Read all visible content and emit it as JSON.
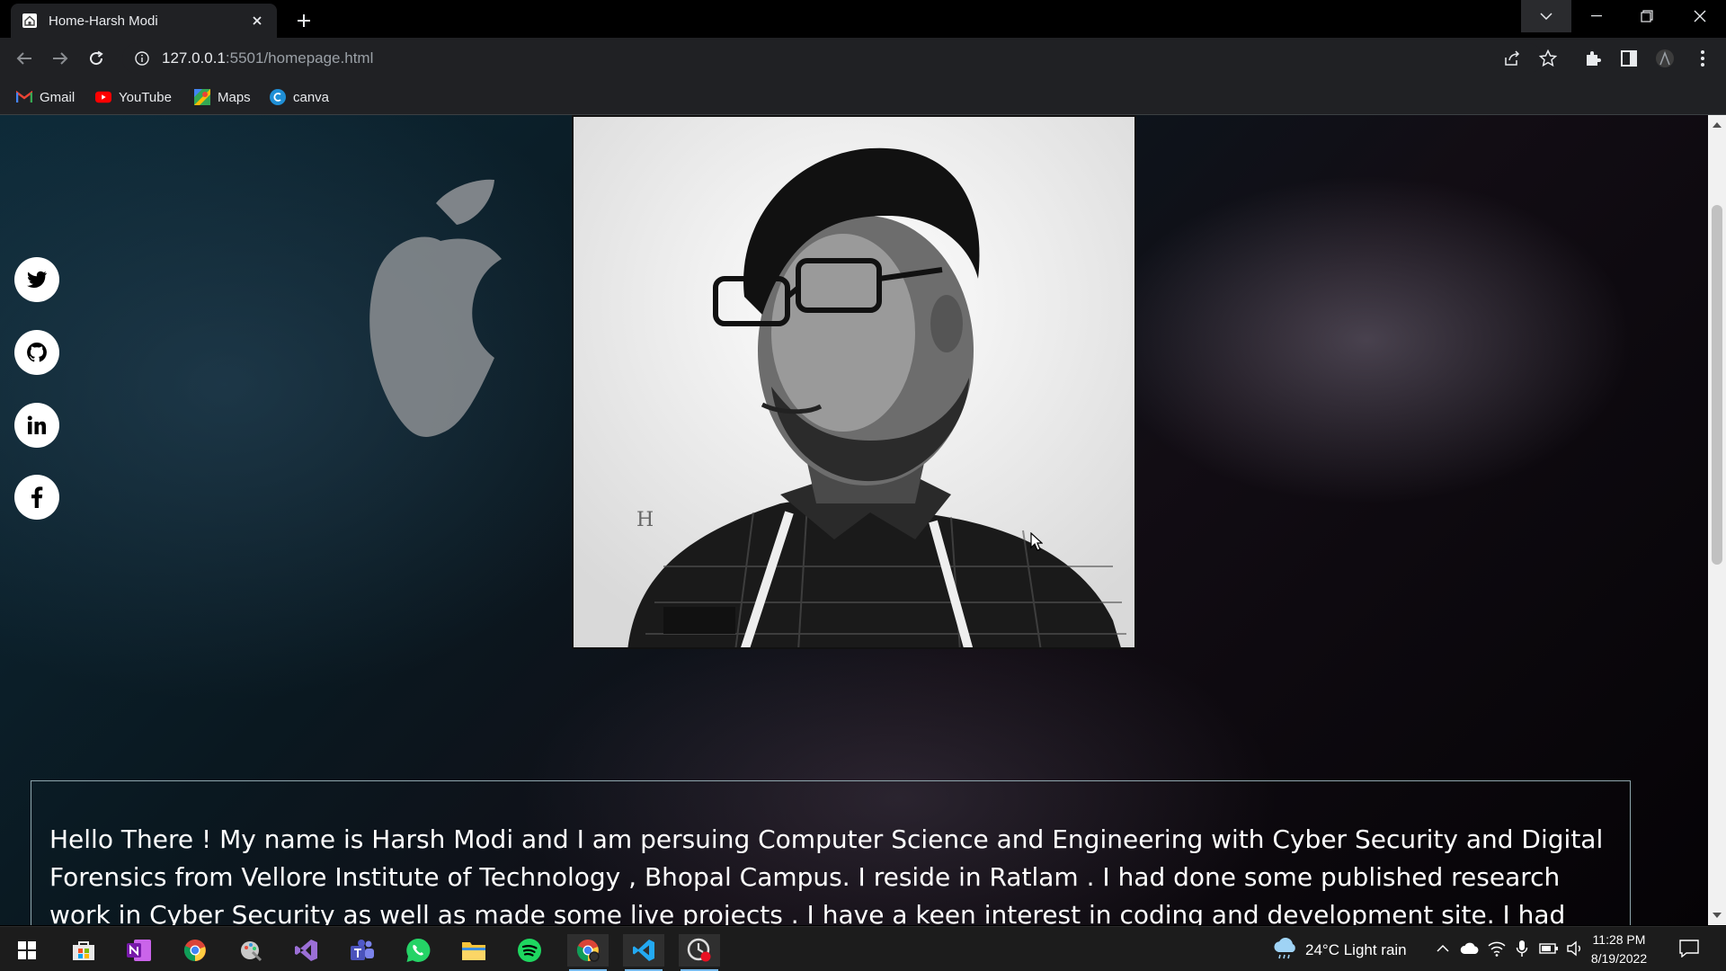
{
  "browser": {
    "tab_title": "Home-Harsh Modi",
    "url_host": "127.0.0.1",
    "url_rest": ":5501/homepage.html",
    "bookmarks": [
      {
        "label": "Gmail",
        "icon": "gmail-icon"
      },
      {
        "label": "YouTube",
        "icon": "youtube-icon"
      },
      {
        "label": "Maps",
        "icon": "maps-icon"
      },
      {
        "label": "canva",
        "icon": "canva-icon"
      }
    ]
  },
  "page": {
    "social_links": [
      "twitter-icon",
      "github-icon",
      "linkedin-icon",
      "facebook-icon"
    ],
    "photo_alt": "profile-photo",
    "about_text": "Hello There ! My name is Harsh Modi and I am persuing Computer Science and Engineering with Cyber Security and Digital Forensics from Vellore Institute of Technology , Bhopal Campus. I reside in Ratlam . I had done some published research work in Cyber Security as well as made some live projects . I have a keen interest in coding and development site. I had taken my"
  },
  "taskbar": {
    "apps": [
      "start-icon",
      "store-icon",
      "onenote-icon",
      "chrome-icon",
      "paint-icon",
      "visual-studio-icon",
      "teams-icon",
      "whatsapp-icon",
      "file-explorer-icon",
      "spotify-icon",
      "chrome-profile-icon",
      "vscode-icon",
      "recorder-icon"
    ],
    "weather": "24°C  Light rain",
    "time": "11:28 PM",
    "date": "8/19/2022"
  },
  "colors": {
    "chrome_bg": "#202124",
    "tab_strip": "#000000",
    "taskbar": "#1c1c1c",
    "about_border": "#8fa6ad"
  }
}
